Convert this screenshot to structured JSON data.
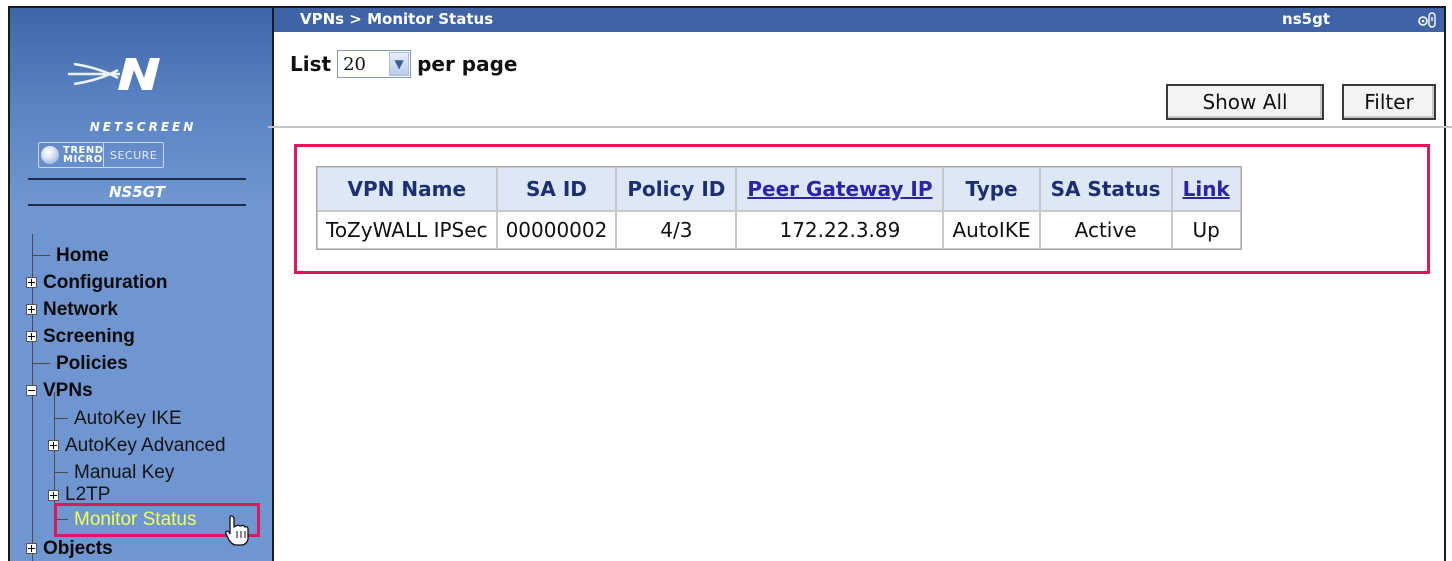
{
  "header": {
    "breadcrumb": "VPNs > Monitor Status",
    "device": "ns5gt"
  },
  "sidebar": {
    "brand": "NETSCREEN",
    "partner_logo": "TREND MICRO",
    "partner_tag": "SECURE",
    "model": "NS5GT",
    "items": [
      {
        "label": "Home",
        "expander": "none"
      },
      {
        "label": "Configuration",
        "expander": "plus"
      },
      {
        "label": "Network",
        "expander": "plus"
      },
      {
        "label": "Screening",
        "expander": "plus"
      },
      {
        "label": "Policies",
        "expander": "none"
      },
      {
        "label": "VPNs",
        "expander": "minus"
      }
    ],
    "vpn_children": [
      {
        "label": "AutoKey IKE",
        "expander": "none"
      },
      {
        "label": "AutoKey Advanced",
        "expander": "plus"
      },
      {
        "label": "Manual Key",
        "expander": "none"
      },
      {
        "label": "L2TP",
        "expander": "plus"
      },
      {
        "label": "Monitor Status",
        "expander": "none",
        "active": true
      }
    ],
    "after_items": [
      {
        "label": "Objects",
        "expander": "plus"
      }
    ]
  },
  "list_control": {
    "prefix": "List",
    "value": "20",
    "suffix": "per page"
  },
  "buttons": {
    "show_all": "Show All",
    "filter": "Filter"
  },
  "table": {
    "columns": [
      "VPN Name",
      "SA ID",
      "Policy ID",
      "Peer Gateway IP",
      "Type",
      "SA Status",
      "Link"
    ],
    "linked_columns": [
      "Peer Gateway IP",
      "Link"
    ],
    "rows": [
      [
        "ToZyWALL IPSec",
        "00000002",
        "4/3",
        "172.22.3.89",
        "AutoIKE",
        "Active",
        "Up"
      ]
    ]
  },
  "colors": {
    "highlight": "#e2165e",
    "sidebar": "#6f96d0",
    "topbar": "#3e64a7",
    "active_item": "#f2ff55"
  }
}
